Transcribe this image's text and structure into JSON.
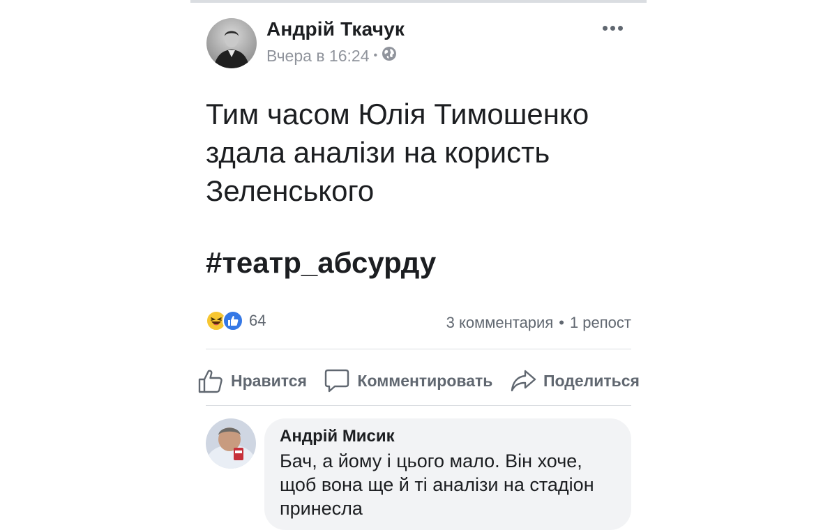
{
  "post": {
    "author": "Андрій Ткачук",
    "timestamp": "Вчера в 16:24",
    "separator": "•",
    "privacy_icon": "globe-icon",
    "more_icon": "ellipsis-icon",
    "text": "Тим часом Юлія Тимошенко здала аналізи на користь Зеленського",
    "hashtag": "#театр_абсурду"
  },
  "stats": {
    "reactions": [
      "haha",
      "like"
    ],
    "reaction_count": "64",
    "comments": "3 комментария",
    "separator": "•",
    "shares": "1 репост"
  },
  "actions": {
    "like": "Нравится",
    "comment": "Комментировать",
    "share": "Поделиться"
  },
  "comment": {
    "author": "Андрій Мисик",
    "text": "Бач, а йому і цього мало. Він хоче, щоб вона ще й ті аналізи на стадіон принесла"
  },
  "colors": {
    "text": "#1c1e21",
    "secondary": "#606770",
    "meta": "#90949c",
    "like_blue": "#3578e5",
    "haha_yellow": "#f7c631",
    "bubble": "#f2f3f5",
    "divider": "#dadde1"
  }
}
